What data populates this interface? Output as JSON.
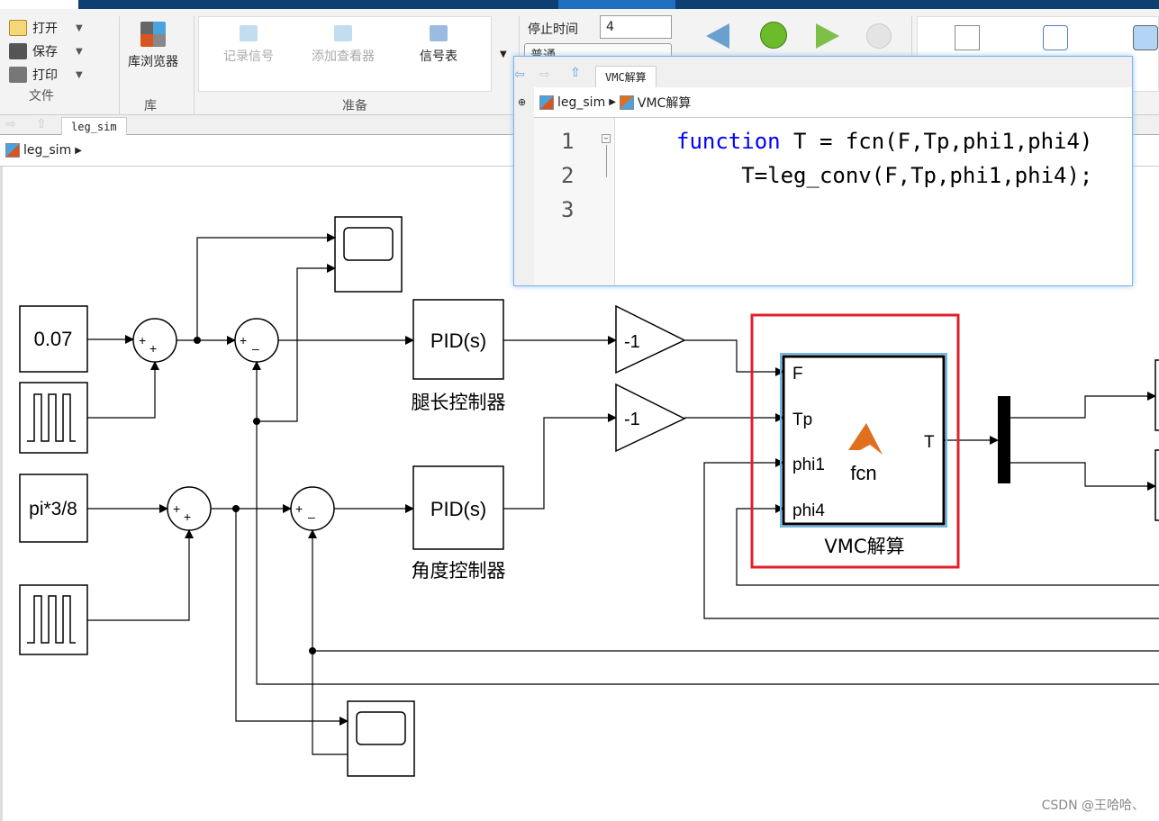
{
  "ribbon": {
    "file": {
      "open": "打开",
      "save": "保存",
      "print": "打印",
      "group": "文件"
    },
    "library": {
      "browser": "库浏览器",
      "group": "库"
    },
    "prepare": {
      "log_signals": "记录信号",
      "add_viewer": "添加查看器",
      "signal_table": "信号表",
      "group": "准备"
    },
    "simulate": {
      "stop_time_label": "停止时间",
      "stop_time_value": "4",
      "mode": "普通"
    },
    "icons": [
      "step-back-icon",
      "run-icon",
      "step-forward-icon",
      "stop-icon",
      "data-inspector-icon",
      "logic-analyzer-icon",
      "birds-eye-icon"
    ]
  },
  "tabbar": {
    "tab": "leg_sim"
  },
  "breadcrumb": {
    "model": "leg_sim"
  },
  "editor": {
    "tab": "VMC解算",
    "breadcrumb": [
      "leg_sim",
      "VMC解算"
    ],
    "lines": [
      {
        "n": "1",
        "kw": "function",
        "rest": " T = fcn(F,Tp,phi1,phi4)"
      },
      {
        "n": "2",
        "kw": "",
        "rest": "     T=leg_conv(F,Tp,phi1,phi4);"
      },
      {
        "n": "3",
        "kw": "",
        "rest": ""
      }
    ]
  },
  "diagram": {
    "const1": "0.07",
    "const2": "pi*3/8",
    "pid": "PID(s)",
    "pid1_label": "腿长控制器",
    "pid2_label": "角度控制器",
    "gain": "-1",
    "vmc": {
      "name": "fcn",
      "label": "VMC解算",
      "inputs": [
        "F",
        "Tp",
        "phi1",
        "phi4"
      ],
      "output": "T"
    },
    "highlight_color": "#e0202a"
  },
  "watermark": "CSDN @王哈哈、"
}
